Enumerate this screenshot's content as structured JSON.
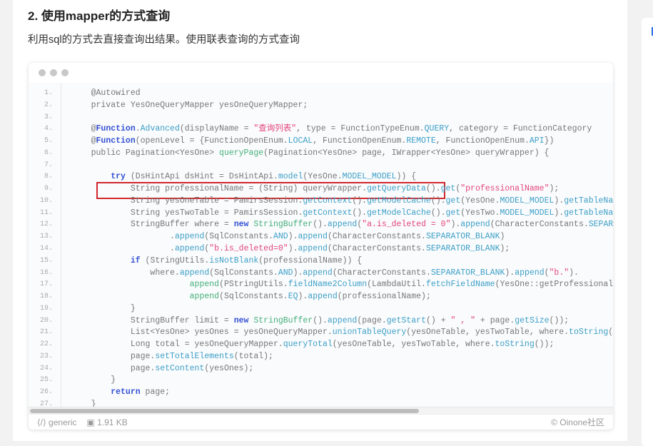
{
  "heading": "2. 使用mapper的方式查询",
  "description": "利用sql的方式去直接查询出结果。使用联表查询的方式查询",
  "code": {
    "lines": [
      [
        [
          "p",
          "    @Autowired"
        ]
      ],
      [
        [
          "p",
          "    private YesOneQueryMapper yesOneQueryMapper;"
        ]
      ],
      [
        [
          "p",
          ""
        ]
      ],
      [
        [
          "p",
          "    @"
        ],
        [
          "k",
          "Function"
        ],
        [
          "p",
          "."
        ],
        [
          "f",
          "Advanced"
        ],
        [
          "p",
          "(displayName = "
        ],
        [
          "s",
          "\"查询列表\""
        ],
        [
          "p",
          ", type = FunctionTypeEnum."
        ],
        [
          "f",
          "QUERY"
        ],
        [
          "p",
          ", category = FunctionCategory"
        ]
      ],
      [
        [
          "p",
          "    @"
        ],
        [
          "k",
          "Function"
        ],
        [
          "p",
          "(openLevel = {FunctionOpenEnum."
        ],
        [
          "f",
          "LOCAL"
        ],
        [
          "p",
          ", FunctionOpenEnum."
        ],
        [
          "f",
          "REMOTE"
        ],
        [
          "p",
          ", FunctionOpenEnum."
        ],
        [
          "f",
          "API"
        ],
        [
          "p",
          "})"
        ]
      ],
      [
        [
          "p",
          "    public Pagination<YesOne> "
        ],
        [
          "g",
          "queryPage"
        ],
        [
          "p",
          "(Pagination<YesOne> page, IWrapper<YesOne> queryWrapper) {"
        ]
      ],
      [
        [
          "p",
          ""
        ]
      ],
      [
        [
          "p",
          "        "
        ],
        [
          "k",
          "try"
        ],
        [
          "p",
          " (DsHintApi dsHint = DsHintApi."
        ],
        [
          "f",
          "model"
        ],
        [
          "p",
          "(YesOne."
        ],
        [
          "f",
          "MODEL_MODEL"
        ],
        [
          "p",
          ")) {"
        ]
      ],
      [
        [
          "p",
          "            String professionalName = (String) queryWrapper."
        ],
        [
          "f",
          "getQueryData"
        ],
        [
          "p",
          "()."
        ],
        [
          "f",
          "get"
        ],
        [
          "p",
          "("
        ],
        [
          "s",
          "\"professionalName\""
        ],
        [
          "p",
          ");"
        ]
      ],
      [
        [
          "p",
          "            String yesOneTable = PamirsSession."
        ],
        [
          "f",
          "getContext"
        ],
        [
          "p",
          "()."
        ],
        [
          "f",
          "getModelCache"
        ],
        [
          "p",
          "()."
        ],
        [
          "f",
          "get"
        ],
        [
          "p",
          "(YesOne."
        ],
        [
          "f",
          "MODEL_MODEL"
        ],
        [
          "p",
          ")."
        ],
        [
          "f",
          "getTableName"
        ],
        [
          "p",
          "();"
        ]
      ],
      [
        [
          "p",
          "            String yesTwoTable = PamirsSession."
        ],
        [
          "f",
          "getContext"
        ],
        [
          "p",
          "()."
        ],
        [
          "f",
          "getModelCache"
        ],
        [
          "p",
          "()."
        ],
        [
          "f",
          "get"
        ],
        [
          "p",
          "(YesTwo."
        ],
        [
          "f",
          "MODEL_MODEL"
        ],
        [
          "p",
          ")."
        ],
        [
          "f",
          "getTableName"
        ],
        [
          "p",
          "();"
        ]
      ],
      [
        [
          "p",
          "            StringBuffer where = "
        ],
        [
          "k",
          "new"
        ],
        [
          "p",
          " "
        ],
        [
          "g",
          "StringBuffer"
        ],
        [
          "p",
          "()."
        ],
        [
          "f",
          "append"
        ],
        [
          "p",
          "("
        ],
        [
          "s",
          "\"a.is_deleted = 0\""
        ],
        [
          "p",
          ")."
        ],
        [
          "f",
          "append"
        ],
        [
          "p",
          "(CharacterConstants."
        ],
        [
          "f",
          "SEPARATOR_BLANK"
        ],
        [
          "p",
          ")"
        ]
      ],
      [
        [
          "p",
          "                    ."
        ],
        [
          "f",
          "append"
        ],
        [
          "p",
          "(SqlConstants."
        ],
        [
          "f",
          "AND"
        ],
        [
          "p",
          ")."
        ],
        [
          "f",
          "append"
        ],
        [
          "p",
          "(CharacterConstants."
        ],
        [
          "f",
          "SEPARATOR_BLANK"
        ],
        [
          "p",
          ")"
        ]
      ],
      [
        [
          "p",
          "                    ."
        ],
        [
          "f",
          "append"
        ],
        [
          "p",
          "("
        ],
        [
          "s",
          "\"b.is_deleted=0\""
        ],
        [
          "p",
          ")."
        ],
        [
          "f",
          "append"
        ],
        [
          "p",
          "(CharacterConstants."
        ],
        [
          "f",
          "SEPARATOR_BLANK"
        ],
        [
          "p",
          ");"
        ]
      ],
      [
        [
          "p",
          "            "
        ],
        [
          "k",
          "if"
        ],
        [
          "p",
          " (StringUtils."
        ],
        [
          "f",
          "isNotBlank"
        ],
        [
          "p",
          "(professionalName)) {"
        ]
      ],
      [
        [
          "p",
          "                where."
        ],
        [
          "f",
          "append"
        ],
        [
          "p",
          "(SqlConstants."
        ],
        [
          "f",
          "AND"
        ],
        [
          "p",
          ")."
        ],
        [
          "f",
          "append"
        ],
        [
          "p",
          "(CharacterConstants."
        ],
        [
          "f",
          "SEPARATOR_BLANK"
        ],
        [
          "p",
          ")."
        ],
        [
          "f",
          "append"
        ],
        [
          "p",
          "("
        ],
        [
          "s",
          "\"b.\""
        ],
        [
          "p",
          ")."
        ]
      ],
      [
        [
          "p",
          "                        "
        ],
        [
          "g",
          "append"
        ],
        [
          "p",
          "(PStringUtils."
        ],
        [
          "f",
          "fieldName2Column"
        ],
        [
          "p",
          "(LambdaUtil."
        ],
        [
          "f",
          "fetchFieldName"
        ],
        [
          "p",
          "(YesOne::getProfessionalName)))."
        ]
      ],
      [
        [
          "p",
          "                        "
        ],
        [
          "g",
          "append"
        ],
        [
          "p",
          "(SqlConstants."
        ],
        [
          "f",
          "EQ"
        ],
        [
          "p",
          ")."
        ],
        [
          "f",
          "append"
        ],
        [
          "p",
          "(professionalName);"
        ]
      ],
      [
        [
          "p",
          "            }"
        ]
      ],
      [
        [
          "p",
          "            StringBuffer limit = "
        ],
        [
          "k",
          "new"
        ],
        [
          "p",
          " "
        ],
        [
          "g",
          "StringBuffer"
        ],
        [
          "p",
          "()."
        ],
        [
          "f",
          "append"
        ],
        [
          "p",
          "(page."
        ],
        [
          "f",
          "getStart"
        ],
        [
          "p",
          "() + "
        ],
        [
          "s",
          "\" , \""
        ],
        [
          "p",
          " + page."
        ],
        [
          "f",
          "getSize"
        ],
        [
          "p",
          "());"
        ]
      ],
      [
        [
          "p",
          "            List<YesOne> yesOnes = yesOneQueryMapper."
        ],
        [
          "f",
          "unionTableQuery"
        ],
        [
          "p",
          "(yesOneTable, yesTwoTable, where."
        ],
        [
          "f",
          "toString"
        ],
        [
          "p",
          "(), limit.toString());"
        ]
      ],
      [
        [
          "p",
          "            Long total = yesOneQueryMapper."
        ],
        [
          "f",
          "queryTotal"
        ],
        [
          "p",
          "(yesOneTable, yesTwoTable, where."
        ],
        [
          "f",
          "toString"
        ],
        [
          "p",
          "());"
        ]
      ],
      [
        [
          "p",
          "            page."
        ],
        [
          "f",
          "setTotalElements"
        ],
        [
          "p",
          "(total);"
        ]
      ],
      [
        [
          "p",
          "            page."
        ],
        [
          "f",
          "setContent"
        ],
        [
          "p",
          "(yesOnes);"
        ]
      ],
      [
        [
          "p",
          "        }"
        ]
      ],
      [
        [
          "p",
          "        "
        ],
        [
          "k",
          "return"
        ],
        [
          "p",
          " page;"
        ]
      ],
      [
        [
          "p",
          "    }"
        ]
      ]
    ],
    "language": "generic",
    "size": "1.91 KB",
    "copyright": "© Oinone社区"
  },
  "colors": {
    "keyword": "#3350d4",
    "method": "#3c9fc7",
    "string": "#e2467a",
    "type": "#45b07c",
    "highlight_box": "#d1262b"
  }
}
